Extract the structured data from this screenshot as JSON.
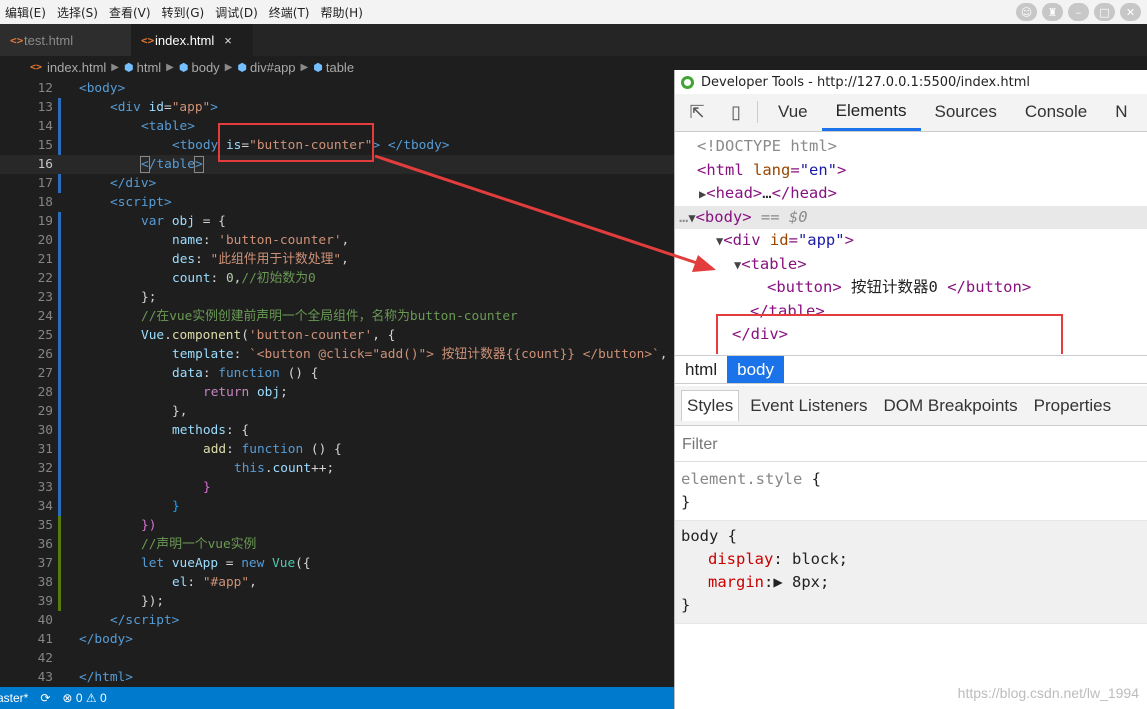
{
  "menubar": {
    "items": [
      "编辑(E)",
      "选择(S)",
      "查看(V)",
      "转到(G)",
      "调试(D)",
      "终端(T)",
      "帮助(H)"
    ]
  },
  "editor": {
    "tabs": [
      {
        "icon": "<>",
        "label": "test.html"
      },
      {
        "icon": "<>",
        "label": "index.html",
        "close": "×"
      }
    ],
    "breadcrumb": [
      "index.html",
      "html",
      "body",
      "div#app",
      "table"
    ],
    "code_lines": [
      {
        "n": "12"
      },
      {
        "n": "13"
      },
      {
        "n": "14"
      },
      {
        "n": "15"
      },
      {
        "n": "16"
      },
      {
        "n": "17"
      },
      {
        "n": "18"
      },
      {
        "n": "19"
      },
      {
        "n": "20"
      },
      {
        "n": "21"
      },
      {
        "n": "22"
      },
      {
        "n": "23"
      },
      {
        "n": "24"
      },
      {
        "n": "25"
      },
      {
        "n": "26"
      },
      {
        "n": "27"
      },
      {
        "n": "28"
      },
      {
        "n": "29"
      },
      {
        "n": "30"
      },
      {
        "n": "31"
      },
      {
        "n": "32"
      },
      {
        "n": "33"
      },
      {
        "n": "34"
      },
      {
        "n": "35"
      },
      {
        "n": "36"
      },
      {
        "n": "37"
      },
      {
        "n": "38"
      },
      {
        "n": "39"
      },
      {
        "n": "40"
      },
      {
        "n": "41"
      },
      {
        "n": "42"
      },
      {
        "n": "43"
      }
    ],
    "code_text": {
      "l12": "<body>",
      "l13_tag": "div",
      "l13_attr": "id",
      "l13_val": "\"app\"",
      "l14": "table",
      "l15_tag": "tbody",
      "l15_attr": "is",
      "l15_val": "\"button-counter\"",
      "l15_close": "tbody",
      "l16": "table",
      "l17": "div",
      "l18": "script",
      "l19": "obj",
      "l20_key": "name",
      "l20_val": "'button-counter'",
      "l21_key": "des",
      "l21_val": "\"此组件用于计数处理\"",
      "l22_key": "count",
      "l22_val": "0",
      "l22_comment": "//初始数为0",
      "l23": "};",
      "l24": "//在vue实例创建前声明一个全局组件，名称为button-counter",
      "l25_obj": "Vue",
      "l25_fn": "component",
      "l25_arg": "'button-counter'",
      "l26_key": "template",
      "l26_val": "`<button @click=\"add()\"> 按钮计数器{{count}} </button>`",
      "l27_key": "data",
      "l27_kw": "function",
      "l28_kw": "return",
      "l28_val": "obj",
      "l29": "},",
      "l30_key": "methods",
      "l31_key": "add",
      "l31_kw": "function",
      "l32_kw": "this",
      "l32_prop": "count",
      "l33": "}",
      "l34": "}",
      "l35": "})",
      "l36": "//声明一个vue实例",
      "l37_kw": "let",
      "l37_var": "vueApp",
      "l37_new": "new",
      "l37_cls": "Vue",
      "l38_key": "el",
      "l38_val": "\"#app\"",
      "l39": "});",
      "l40": "script",
      "l41": "body",
      "l43": "html"
    },
    "status": {
      "branch": "aster*",
      "sync_icon": "sync-icon",
      "errors": "0",
      "warnings": "0"
    }
  },
  "devtools": {
    "title": "Developer Tools - http://127.0.0.1:5500/index.html",
    "tabs": [
      "Vue",
      "Elements",
      "Sources",
      "Console",
      "N"
    ],
    "active_tab": "Elements",
    "dom": {
      "doctype": "<!DOCTYPE html>",
      "html_open": "html",
      "html_attr": "lang",
      "html_val": "\"en\"",
      "head": "head",
      "body_tag": "body",
      "body_eq": " == $0",
      "div_tag": "div",
      "div_attr": "id",
      "div_val": "\"app\"",
      "table_tag": "table",
      "button_tag": "button",
      "button_text": " 按钮计数器0 ",
      "table_close": "table",
      "div_close": "div"
    },
    "breadcrumbs": [
      "html",
      "body"
    ],
    "subtabs": [
      "Styles",
      "Event Listeners",
      "DOM Breakpoints",
      "Properties"
    ],
    "filter_placeholder": "Filter",
    "rules": {
      "element_style": "element.style",
      "body_selector": "body",
      "props": [
        {
          "name": "display",
          "value": "block;"
        },
        {
          "name": "margin",
          "value": "8px;"
        }
      ]
    }
  },
  "watermark": "https://blog.csdn.net/lw_1994",
  "colors": {
    "highlight": "#e23c3c",
    "status_bar": "#007acc",
    "devtools_accent": "#1a73e8"
  }
}
